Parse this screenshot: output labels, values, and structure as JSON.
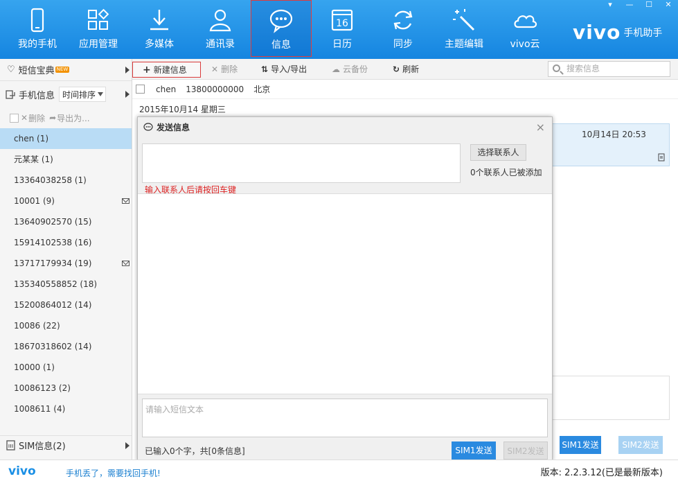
{
  "nav": {
    "items": [
      {
        "label": "我的手机",
        "icon": "phone-icon"
      },
      {
        "label": "应用管理",
        "icon": "apps-icon"
      },
      {
        "label": "多媒体",
        "icon": "download-icon"
      },
      {
        "label": "通讯录",
        "icon": "contact-icon"
      },
      {
        "label": "信息",
        "icon": "message-icon"
      },
      {
        "label": "日历",
        "icon": "calendar-icon"
      },
      {
        "label": "同步",
        "icon": "sync-icon"
      },
      {
        "label": "主题编辑",
        "icon": "magic-wand-icon"
      },
      {
        "label": "vivo云",
        "icon": "cloud-icon"
      }
    ],
    "active_index": 4,
    "calendar_day": "16",
    "brand_logo": "vivo",
    "brand_sub": "手机助手",
    "accent": "#1a8fe5"
  },
  "left": {
    "sms_treasure": "短信宝典",
    "new_badge": "NEW",
    "phone_info": "手机信息",
    "sort_label": "时间排序",
    "delete_label": "删除",
    "export_label": "导出为...",
    "sim_info": "SIM信息(2)",
    "contacts": [
      {
        "name": "chen (1)",
        "mail": false
      },
      {
        "name": "元某某 (1)",
        "mail": false
      },
      {
        "name": "13364038258 (1)",
        "mail": false
      },
      {
        "name": "10001 (9)",
        "mail": true
      },
      {
        "name": "13640902570 (15)",
        "mail": false
      },
      {
        "name": "15914102538 (16)",
        "mail": false
      },
      {
        "name": "13717179934 (19)",
        "mail": true
      },
      {
        "name": "135340558852 (18)",
        "mail": false
      },
      {
        "name": "15200864012 (14)",
        "mail": false
      },
      {
        "name": "10086 (22)",
        "mail": false
      },
      {
        "name": "18670318602 (14)",
        "mail": false
      },
      {
        "name": "10000 (1)",
        "mail": false
      },
      {
        "name": "10086123 (2)",
        "mail": false
      },
      {
        "name": "1008611 (4)",
        "mail": false
      }
    ],
    "selected_index": 0
  },
  "toolbar": {
    "new_label": "新建信息",
    "delete_label": "删除",
    "import_export_label": "导入/导出",
    "cloud_backup_label": "云备份",
    "refresh_label": "刷新",
    "search_placeholder": "搜索信息"
  },
  "conversation": {
    "name": "chen",
    "number": "13800000000",
    "location": "北京",
    "date": "2015年10月14 星期三",
    "bubble_time": "10月14日 20:53",
    "sim1_send": "SIM1发送",
    "sim2_send": "SIM2发送"
  },
  "dialog": {
    "title": "发送信息",
    "close": "×",
    "pick_contact": "选择联系人",
    "added_count": "0个联系人已被添加",
    "hint": "输入联系人后请按回车键",
    "sms_placeholder": "请输入短信文本",
    "char_count": "已输入0个字，共[0条信息]",
    "sim1_send": "SIM1发送",
    "sim2_send": "SIM2发送"
  },
  "footer": {
    "logo": "vivo",
    "lost_phone": "手机丢了，需要找回手机!",
    "version": "版本: 2.2.3.12(已是最新版本)"
  },
  "window_controls": [
    "▾",
    "—",
    "☐",
    "✕"
  ]
}
